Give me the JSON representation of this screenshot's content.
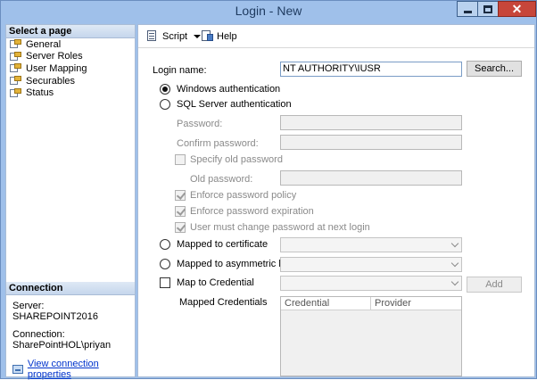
{
  "window": {
    "title": "Login - New",
    "close_glyph": "✕"
  },
  "left": {
    "select_page_header": "Select a page",
    "pages": [
      "General",
      "Server Roles",
      "User Mapping",
      "Securables",
      "Status"
    ],
    "connection_header": "Connection",
    "server_label": "Server:",
    "server_value": "SHAREPOINT2016",
    "connection_label": "Connection:",
    "connection_value": "SharePointHOL\\priyan",
    "view_properties_link": "View connection properties"
  },
  "toolbar": {
    "script_label": "Script",
    "help_label": "Help"
  },
  "general": {
    "login_name_label": "Login name:",
    "login_name_value": "NT AUTHORITY\\IUSR",
    "search_button": "Search...",
    "windows_auth": "Windows authentication",
    "sql_auth": "SQL Server authentication",
    "password_label": "Password:",
    "confirm_password_label": "Confirm password:",
    "specify_old_password": "Specify old password",
    "old_password_label": "Old password:",
    "enforce_policy": "Enforce password policy",
    "enforce_expiration": "Enforce password expiration",
    "must_change": "User must change password at next login",
    "mapped_certificate": "Mapped to certificate",
    "mapped_asym_key": "Mapped to asymmetric key",
    "map_credential": "Map to Credential",
    "add_button": "Add",
    "mapped_credentials_label": "Mapped Credentials",
    "grid_columns": [
      "Credential",
      "Provider"
    ]
  },
  "state": {
    "auth_mode": "windows",
    "enforce_policy_checked": true,
    "enforce_expiration_checked": true,
    "must_change_checked": true,
    "specify_old_password_checked": false,
    "map_credential_checked": false
  },
  "icons": {
    "page_icon": "page-properties-icon",
    "script_icon": "script-icon",
    "help_icon": "help-icon",
    "link_icon": "connection-properties-icon"
  }
}
